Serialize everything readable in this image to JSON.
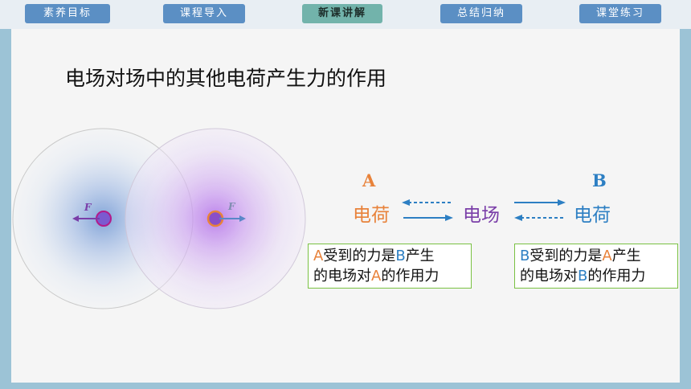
{
  "nav": {
    "tabs": [
      {
        "label": "素养目标"
      },
      {
        "label": "课程导入"
      },
      {
        "label": "新课讲解"
      },
      {
        "label": "总结归纳"
      },
      {
        "label": "课堂练习"
      }
    ],
    "active_index": 2
  },
  "slide": {
    "title": "电场对场中的其他电荷产生力的作用",
    "force_label_left": "F",
    "force_label_right": "F",
    "label_a": "A",
    "label_b": "B",
    "charge_a": "电荷",
    "field": "电场",
    "charge_b": "电荷",
    "box_left": {
      "p1": "A",
      "p2": "受到的力是",
      "p3": "B",
      "p4": "产生",
      "p5": "的电场对",
      "p6": "A",
      "p7": "的作用力"
    },
    "box_right": {
      "p1": "B",
      "p2": "受到的力是",
      "p3": "A",
      "p4": "产生",
      "p5": "的电场对",
      "p6": "B",
      "p7": "的作用力"
    }
  },
  "colors": {
    "a": "#e8823a",
    "b": "#2d7fc3",
    "field": "#7a3ea8",
    "box_border": "#7ac143"
  }
}
